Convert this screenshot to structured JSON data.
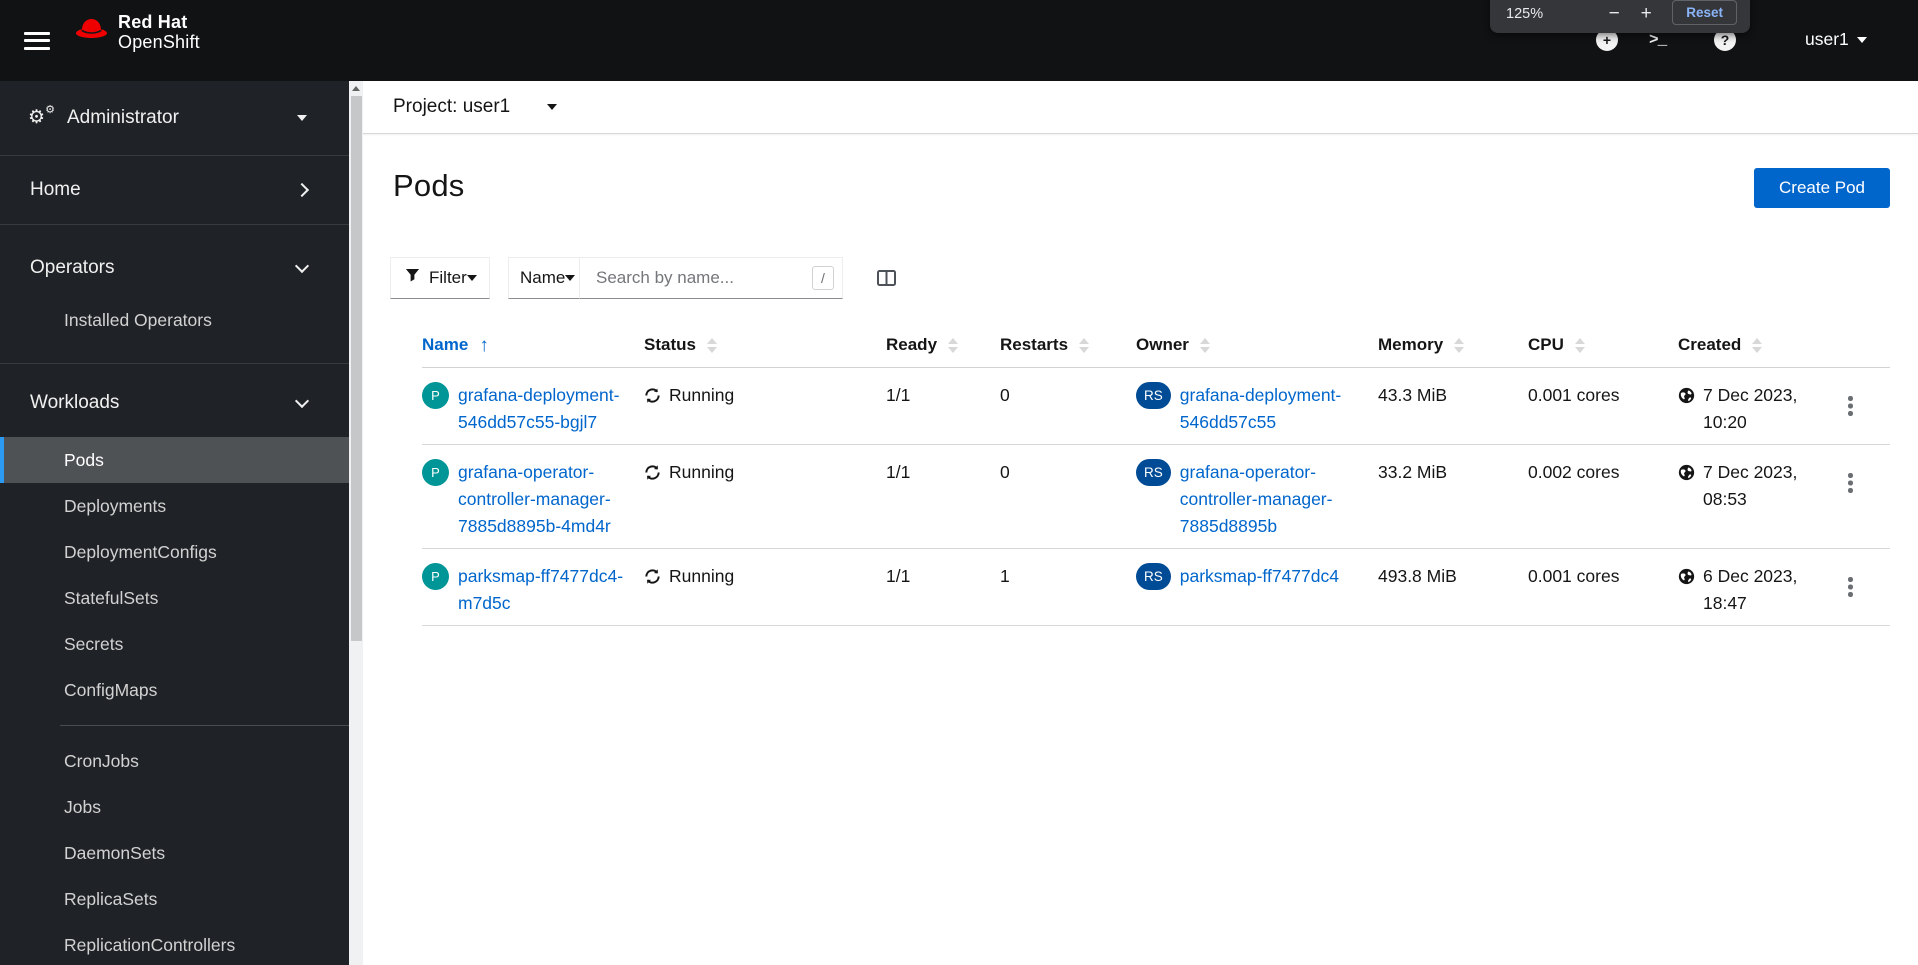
{
  "masthead": {
    "brand_line1": "Red Hat",
    "brand_line2": "OpenShift",
    "zoom_popup": {
      "level": "125%",
      "minus": "−",
      "plus": "+",
      "reset": "Reset"
    },
    "user": "user1"
  },
  "sidebar": {
    "perspective": "Administrator",
    "home": "Home",
    "operators": "Operators",
    "installed_operators": "Installed Operators",
    "workloads": "Workloads",
    "workloads_items": [
      "Pods",
      "Deployments",
      "DeploymentConfigs",
      "StatefulSets",
      "Secrets",
      "ConfigMaps",
      "CronJobs",
      "Jobs",
      "DaemonSets",
      "ReplicaSets",
      "ReplicationControllers"
    ],
    "active_item": "Pods"
  },
  "content": {
    "project_bar": {
      "label": "Project: user1"
    },
    "page_title": "Pods",
    "create_button": "Create Pod",
    "toolbar": {
      "filter": "Filter",
      "name": "Name",
      "search_placeholder": "Search by name...",
      "shortcut": "/"
    },
    "table": {
      "columns": [
        "Name",
        "Status",
        "Ready",
        "Restarts",
        "Owner",
        "Memory",
        "CPU",
        "Created"
      ],
      "sorted_column": "Name",
      "sort_direction": "ascending",
      "rows": [
        {
          "badge": "P",
          "name": "grafana-deployment-\n546dd57c55-bgjl7",
          "status": "Running",
          "ready": "1/1",
          "restarts": "0",
          "owner_badge": "RS",
          "owner": "grafana-deployment-\n546dd57c55",
          "memory": "43.3 MiB",
          "cpu": "0.001 cores",
          "created": "7 Dec 2023,\n10:20"
        },
        {
          "badge": "P",
          "name": "grafana-operator-\ncontroller-manager-\n7885d8895b-4md4r",
          "status": "Running",
          "ready": "1/1",
          "restarts": "0",
          "owner_badge": "RS",
          "owner": "grafana-operator-\ncontroller-manager-\n7885d8895b",
          "memory": "33.2 MiB",
          "cpu": "0.002 cores",
          "created": "7 Dec 2023,\n08:53"
        },
        {
          "badge": "P",
          "name": "parksmap-ff7477dc4-\nm7d5c",
          "status": "Running",
          "ready": "1/1",
          "restarts": "1",
          "owner_badge": "RS",
          "owner": "parksmap-ff7477dc4",
          "memory": "493.8 MiB",
          "cpu": "0.001 cores",
          "created": "6 Dec 2023,\n18:47"
        }
      ]
    }
  },
  "colors": {
    "masthead_bg": "#101214",
    "sidebar_bg": "#1f2226",
    "active_nav_bg": "#4f5255",
    "active_nav_border": "#2b9af3",
    "link_blue": "#0066cc",
    "primary_button": "#0066cc",
    "pod_badge": "#009596",
    "replicaset_badge": "#004b95",
    "redhat_red": "#ee0000"
  }
}
